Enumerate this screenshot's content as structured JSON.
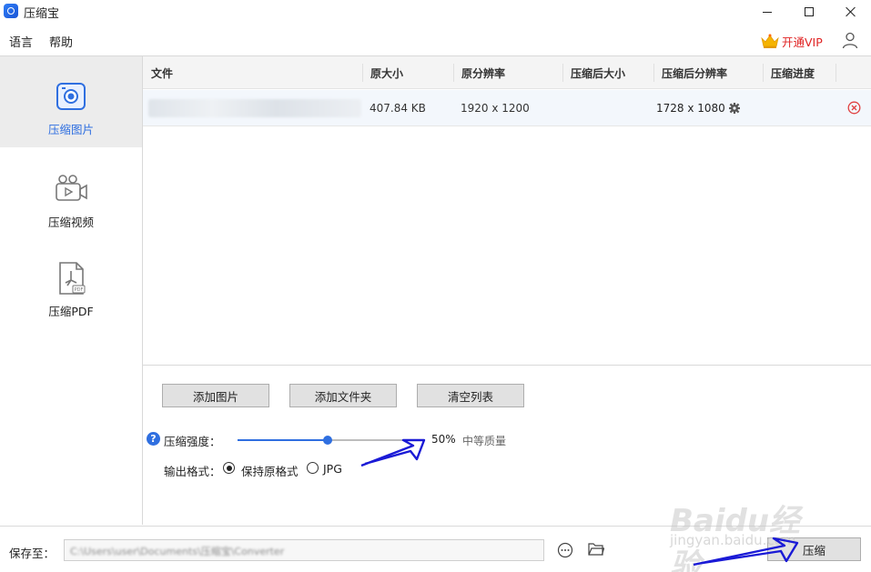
{
  "window": {
    "title": "压缩宝"
  },
  "menu": {
    "language": "语言",
    "help": "帮助",
    "vip": "开通VIP"
  },
  "sidebar": {
    "items": [
      {
        "label": "压缩图片",
        "icon": "camera-icon",
        "active": true
      },
      {
        "label": "压缩视频",
        "icon": "video-camera-icon",
        "active": false
      },
      {
        "label": "压缩PDF",
        "icon": "pdf-file-icon",
        "active": false
      }
    ]
  },
  "table": {
    "headers": [
      "文件",
      "原大小",
      "原分辨率",
      "压缩后大小",
      "压缩后分辨率",
      "压缩进度"
    ],
    "rows": [
      {
        "file": "",
        "original_size": "407.84 KB",
        "original_resolution": "1920 x 1200",
        "compressed_size": "",
        "compressed_resolution": "1728 x 1080",
        "progress": ""
      }
    ]
  },
  "controls": {
    "add_image": "添加图片",
    "add_folder": "添加文件夹",
    "clear_list": "清空列表",
    "strength_label": "压缩强度：",
    "strength_value": "50%",
    "strength_fraction": 0.5,
    "quality_label": "中等质量",
    "format_label": "输出格式：",
    "format_keep": "保持原格式",
    "format_jpg": "JPG"
  },
  "bottom": {
    "save_to_label": "保存至：",
    "save_path": "C:\\Users\\user\\Documents\\压缩宝\\Converter",
    "compress_button": "压缩"
  },
  "watermark": {
    "text": "Baidu经验",
    "sub": "jingyan.baidu.com"
  },
  "colors": {
    "accent": "#2f6fe0",
    "vip": "#e02323",
    "annotation": "#1a1ad6",
    "remove": "#e04040"
  }
}
